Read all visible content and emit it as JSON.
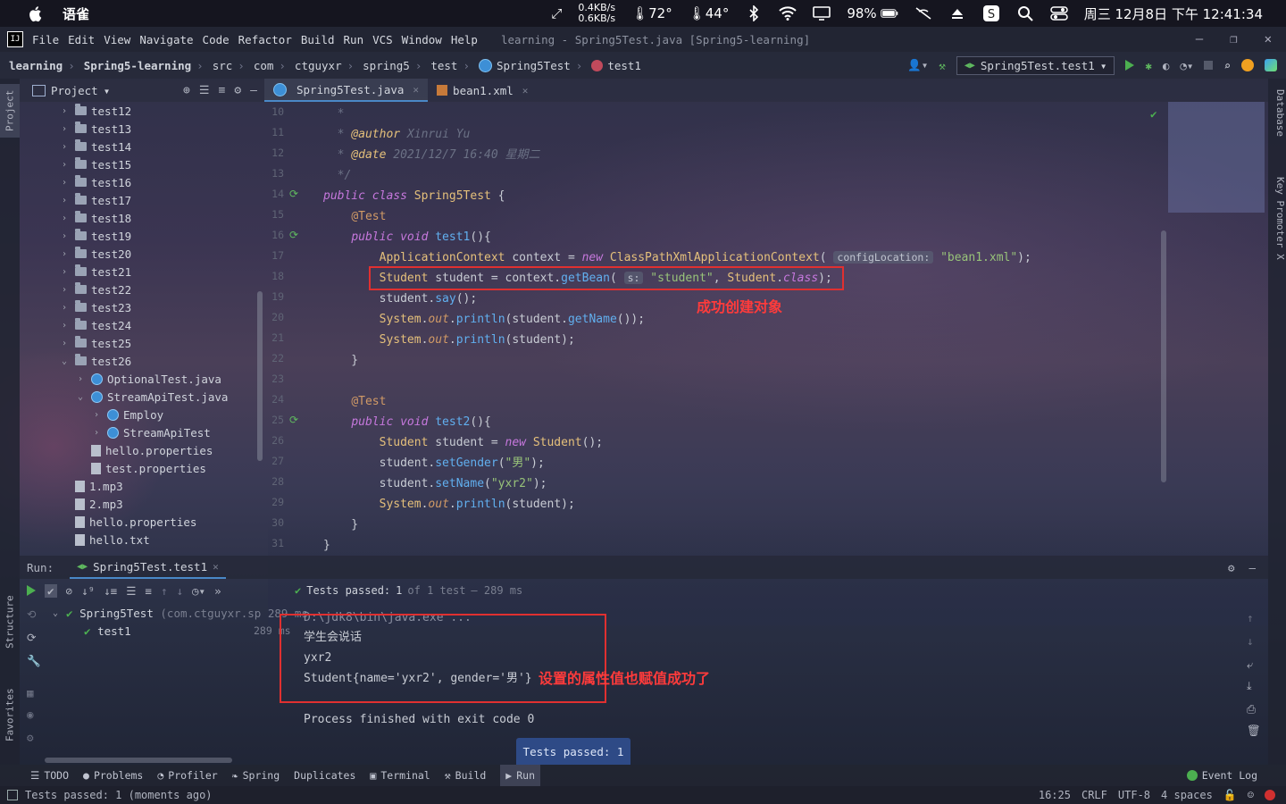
{
  "menubar": {
    "app_name": "语雀",
    "net_up": "0.4KB/s",
    "net_down": "0.6KB/s",
    "temp1": "72°",
    "temp2": "44°",
    "battery": "98%",
    "datetime": "周三 12月8日 下午 12:41:34"
  },
  "ide_menu": {
    "items": [
      "File",
      "Edit",
      "View",
      "Navigate",
      "Code",
      "Refactor",
      "Build",
      "Run",
      "VCS",
      "Window",
      "Help"
    ],
    "window_title": "learning - Spring5Test.java [Spring5-learning]"
  },
  "breadcrumb": [
    "learning",
    "Spring5-learning",
    "src",
    "com",
    "ctguyxr",
    "spring5",
    "test",
    "Spring5Test",
    "test1"
  ],
  "run_config": "Spring5Test.test1",
  "project_panel": {
    "title": "Project",
    "nodes": [
      {
        "label": "test12",
        "depth": 0,
        "kind": "folder",
        "open": false
      },
      {
        "label": "test13",
        "depth": 0,
        "kind": "folder",
        "open": false
      },
      {
        "label": "test14",
        "depth": 0,
        "kind": "folder",
        "open": false
      },
      {
        "label": "test15",
        "depth": 0,
        "kind": "folder",
        "open": false
      },
      {
        "label": "test16",
        "depth": 0,
        "kind": "folder",
        "open": false
      },
      {
        "label": "test17",
        "depth": 0,
        "kind": "folder",
        "open": false
      },
      {
        "label": "test18",
        "depth": 0,
        "kind": "folder",
        "open": false
      },
      {
        "label": "test19",
        "depth": 0,
        "kind": "folder",
        "open": false
      },
      {
        "label": "test20",
        "depth": 0,
        "kind": "folder",
        "open": false
      },
      {
        "label": "test21",
        "depth": 0,
        "kind": "folder",
        "open": false
      },
      {
        "label": "test22",
        "depth": 0,
        "kind": "folder",
        "open": false
      },
      {
        "label": "test23",
        "depth": 0,
        "kind": "folder",
        "open": false
      },
      {
        "label": "test24",
        "depth": 0,
        "kind": "folder",
        "open": false
      },
      {
        "label": "test25",
        "depth": 0,
        "kind": "folder",
        "open": false
      },
      {
        "label": "test26",
        "depth": 0,
        "kind": "folder",
        "open": true
      },
      {
        "label": "OptionalTest.java",
        "depth": 1,
        "kind": "class",
        "open": false
      },
      {
        "label": "StreamApiTest.java",
        "depth": 1,
        "kind": "class",
        "open": true
      },
      {
        "label": "Employ",
        "depth": 2,
        "kind": "class",
        "open": false
      },
      {
        "label": "StreamApiTest",
        "depth": 2,
        "kind": "class",
        "open": false
      },
      {
        "label": "hello.properties",
        "depth": 1,
        "kind": "file",
        "open": null
      },
      {
        "label": "test.properties",
        "depth": 1,
        "kind": "file",
        "open": null
      },
      {
        "label": "1.mp3",
        "depth": -1,
        "kind": "file",
        "open": null
      },
      {
        "label": "2.mp3",
        "depth": -1,
        "kind": "file",
        "open": null
      },
      {
        "label": "hello.properties",
        "depth": -1,
        "kind": "file",
        "open": null
      },
      {
        "label": "hello.txt",
        "depth": -1,
        "kind": "file",
        "open": null
      }
    ]
  },
  "editor": {
    "tabs": [
      {
        "label": "Spring5Test.java",
        "active": true
      },
      {
        "label": "bean1.xml",
        "active": false
      }
    ],
    "line_numbers": [
      "10",
      "11",
      "12",
      "13",
      "14",
      "15",
      "16",
      "17",
      "18",
      "19",
      "20",
      "21",
      "22",
      "23",
      "24",
      "25",
      "26",
      "27",
      "28",
      "29",
      "30",
      "31"
    ],
    "annotation_1": "成功创建对象"
  },
  "run_panel": {
    "label": "Run:",
    "tab": "Spring5Test.test1",
    "status_prefix": "Tests passed:",
    "status_count": "1",
    "status_of": "of 1 test",
    "status_time": "– 289 ms",
    "tests": [
      {
        "name": "Spring5Test",
        "detail": "(com.ctguyxr.sp",
        "time": "289 ms"
      },
      {
        "name": "test1",
        "detail": "",
        "time": "289 ms"
      }
    ],
    "console_lines": [
      "D:\\jdk8\\bin\\java.exe ...",
      "学生会说话",
      "yxr2",
      "Student{name='yxr2', gender='男'}",
      "",
      "Process finished with exit code 0"
    ],
    "annotation_2": "设置的属性值也赋值成功了",
    "popup": "Tests passed: 1"
  },
  "tool_windows": [
    "TODO",
    "Problems",
    "Profiler",
    "Spring",
    "Duplicates",
    "Terminal",
    "Build",
    "Run"
  ],
  "event_log": "Event Log",
  "left_strip": [
    "Project",
    "Structure",
    "Favorites"
  ],
  "right_strip": [
    "Database",
    "Key Promoter X"
  ],
  "status_bar": {
    "message": "Tests passed: 1 (moments ago)",
    "position": "16:25",
    "line_sep": "CRLF",
    "encoding": "UTF-8",
    "indent": "4 spaces"
  }
}
